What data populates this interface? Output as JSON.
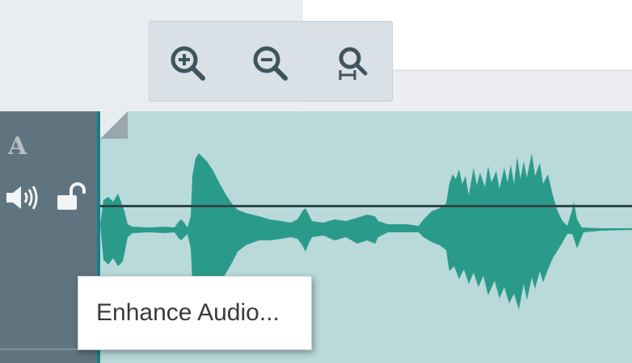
{
  "zoom_toolbar": {
    "buttons": [
      {
        "icon": "zoom-in-icon"
      },
      {
        "icon": "zoom-out-icon"
      },
      {
        "icon": "zoom-fit-icon"
      }
    ]
  },
  "track": {
    "type_label": "A",
    "volume_icon": "volume-icon",
    "lock_icon": "unlocked-icon"
  },
  "context_menu": {
    "items": [
      {
        "label": "Enhance Audio..."
      }
    ]
  },
  "colors": {
    "track_background": "#b9d9da",
    "waveform": "#2a9b8a",
    "track_header": "#5f747f",
    "playhead": "#177f86"
  }
}
